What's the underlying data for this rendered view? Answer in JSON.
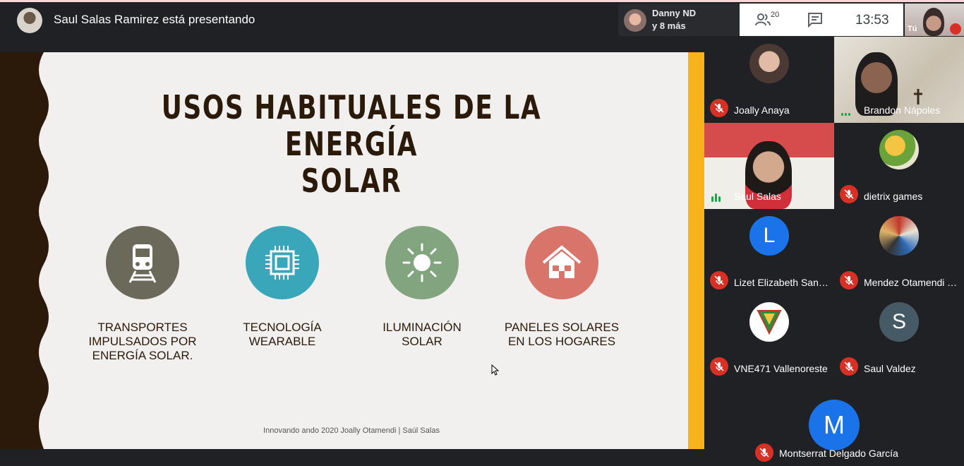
{
  "presenter": {
    "text": "Saul Salas Ramirez está presentando"
  },
  "others": {
    "name": "Danny ND",
    "more": "y 8 más"
  },
  "controls": {
    "people_count": "20",
    "time": "13:53"
  },
  "self": {
    "label": "Tú"
  },
  "slide": {
    "title_line1": "USOS HABITUALES DE LA ENERGÍA",
    "title_line2": "SOLAR",
    "items": [
      {
        "icon": "train-icon",
        "color": "#6b6a5a",
        "line1": "TRANSPORTES",
        "line2": "IMPULSADOS POR",
        "line3": "ENERGÍA SOLAR."
      },
      {
        "icon": "chip-icon",
        "color": "#3aa6b9",
        "line1": "TECNOLOGÍA",
        "line2": "WEARABLE",
        "line3": ""
      },
      {
        "icon": "sun-icon",
        "color": "#82a47e",
        "line1": "ILUMINACIÓN",
        "line2": "SOLAR",
        "line3": ""
      },
      {
        "icon": "house-icon",
        "color": "#d9746a",
        "line1": "PANELES SOLARES",
        "line2": "EN LOS HOGARES",
        "line3": ""
      }
    ],
    "footer": "Innovando ando 2020  Joally Otamendi | Saúl Salas"
  },
  "participants": [
    {
      "name": "Joally Anaya",
      "muted": true
    },
    {
      "name": "Brandon Nápoles",
      "muted": false
    },
    {
      "name": "Saul Salas",
      "muted": false
    },
    {
      "name": "dietrix games",
      "muted": true
    },
    {
      "name": "Lizet Elizabeth Sanc…",
      "muted": true,
      "initial": "L",
      "avatar_color": "#1a73e8"
    },
    {
      "name": "Mendez Otamendi Y…",
      "muted": true
    },
    {
      "name": "VNE471 Vallenoreste",
      "muted": true
    },
    {
      "name": "Saul Valdez",
      "muted": true,
      "initial": "S",
      "avatar_color": "#455a64"
    },
    {
      "name": "Montserrat Delgado García",
      "muted": true,
      "initial": "M",
      "avatar_color": "#1a73e8"
    }
  ]
}
